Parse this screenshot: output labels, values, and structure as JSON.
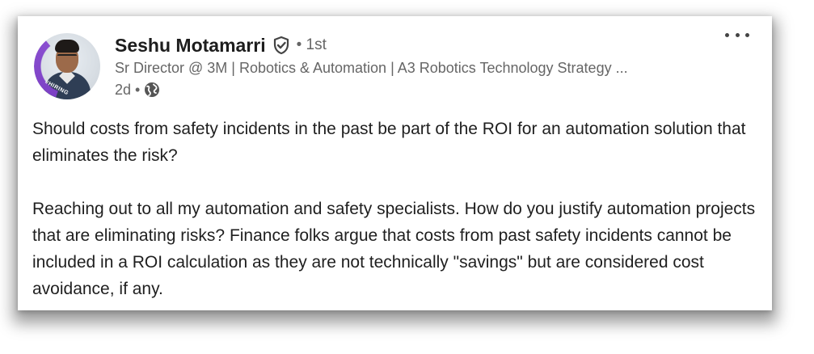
{
  "author": {
    "name": "Seshu Motamarri",
    "connection_degree": "• 1st",
    "headline": "Sr Director @ 3M | Robotics & Automation | A3 Robotics Technology Strategy ...",
    "post_age": "2d •",
    "avatar_badge": "#HIRING"
  },
  "post": {
    "paragraph_1": "Should costs from safety incidents in the past be part of the ROI for an automation solution that eliminates the risk?",
    "paragraph_2": "Reaching out to all my automation and safety specialists. How do you justify automation projects that are eliminating risks? Finance folks argue that costs from past safety incidents cannot be included in a ROI calculation as they are not technically \"savings\" but are considered cost avoidance, if any."
  },
  "icons": {
    "verified": "shield-check-icon",
    "visibility": "globe-icon",
    "menu": "more-horizontal-icon"
  },
  "colors": {
    "text_primary": "#1d1d1d",
    "text_secondary": "#666666",
    "hiring_ring": "#7b3fc4"
  }
}
